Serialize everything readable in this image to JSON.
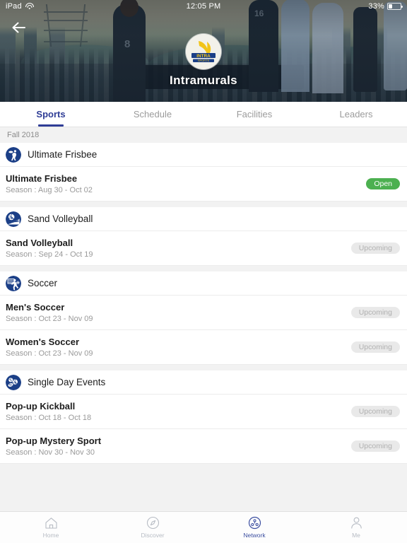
{
  "status_bar": {
    "device": "iPad",
    "wifi_icon": "wifi-icon",
    "time": "12:05 PM",
    "battery_percent": "33%",
    "battery_icon": "battery-icon"
  },
  "hero": {
    "back_icon": "back-arrow-icon",
    "logo_alt": "intramurals-logo",
    "title": "Intramurals"
  },
  "tabs": [
    {
      "label": "Sports",
      "active": true
    },
    {
      "label": "Schedule",
      "active": false
    },
    {
      "label": "Facilities",
      "active": false
    },
    {
      "label": "Leaders",
      "active": false
    }
  ],
  "season_header": "Fall 2018",
  "groups": [
    {
      "name": "Ultimate Frisbee",
      "icon": "ultimate-frisbee-icon",
      "rows": [
        {
          "title": "Ultimate Frisbee",
          "season": "Season : Aug 30 - Oct 02",
          "badge": "Open",
          "badge_state": "open"
        }
      ]
    },
    {
      "name": "Sand Volleyball",
      "icon": "sand-volleyball-icon",
      "rows": [
        {
          "title": "Sand Volleyball",
          "season": "Season : Sep 24 - Oct 19",
          "badge": "Upcoming",
          "badge_state": "upcoming"
        }
      ]
    },
    {
      "name": "Soccer",
      "icon": "soccer-icon",
      "rows": [
        {
          "title": "Men's Soccer",
          "season": "Season : Oct 23 - Nov 09",
          "badge": "Upcoming",
          "badge_state": "upcoming"
        },
        {
          "title": "Women's Soccer",
          "season": "Season : Oct 23 - Nov 09",
          "badge": "Upcoming",
          "badge_state": "upcoming"
        }
      ]
    },
    {
      "name": "Single Day Events",
      "icon": "single-day-events-icon",
      "rows": [
        {
          "title": "Pop-up Kickball",
          "season": "Season : Oct 18 - Oct 18",
          "badge": "Upcoming",
          "badge_state": "upcoming"
        },
        {
          "title": "Pop-up Mystery Sport",
          "season": "Season : Nov 30 - Nov 30",
          "badge": "Upcoming",
          "badge_state": "upcoming"
        }
      ]
    }
  ],
  "bottom_nav": [
    {
      "label": "Home",
      "icon": "home-icon",
      "active": false
    },
    {
      "label": "Discover",
      "icon": "compass-icon",
      "active": false
    },
    {
      "label": "Network",
      "icon": "network-icon",
      "active": true
    },
    {
      "label": "Me",
      "icon": "person-icon",
      "active": false
    }
  ],
  "colors": {
    "accent": "#2f3d96",
    "open_badge": "#4cb050",
    "upcoming_badge": "#e9e9e9",
    "nav_active": "#3b4ea0",
    "sport_icon": "#1b3f87"
  }
}
